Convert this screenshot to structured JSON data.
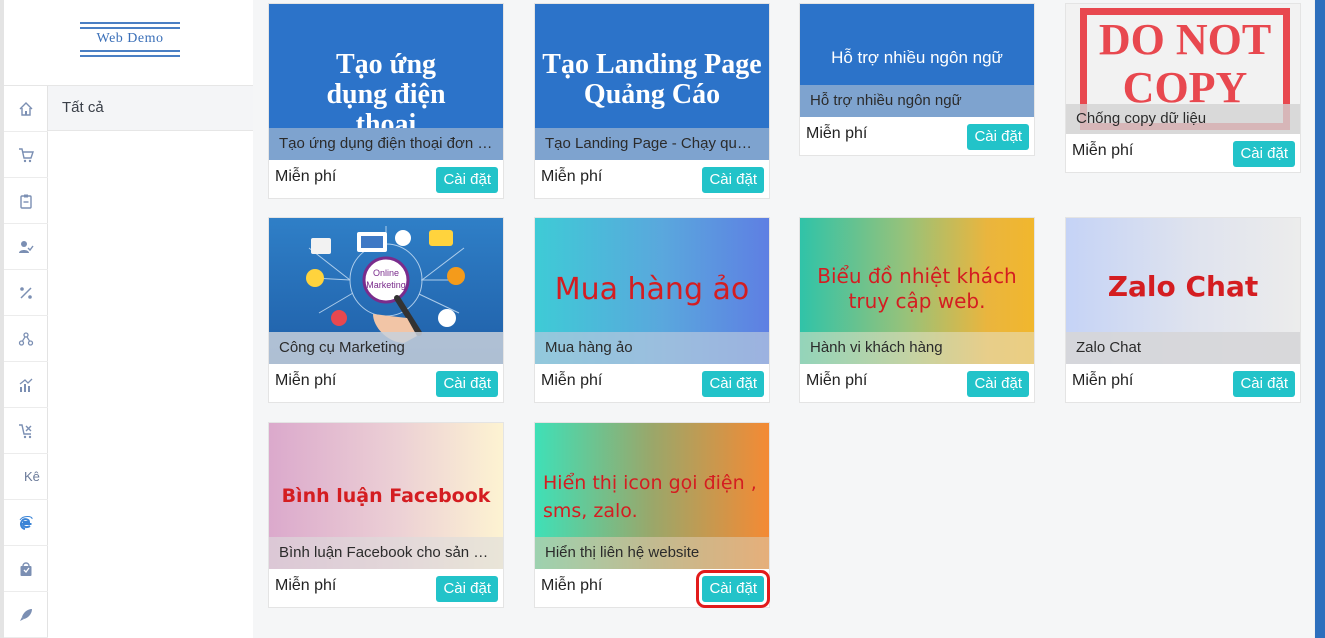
{
  "logo": {
    "text": "Web Demo"
  },
  "sidebar": {
    "rail": [
      {
        "icon": "home-icon"
      },
      {
        "icon": "cart-icon"
      },
      {
        "icon": "clipboard-icon"
      },
      {
        "icon": "user-check-icon"
      },
      {
        "icon": "percent-icon"
      },
      {
        "icon": "network-icon"
      },
      {
        "icon": "chart-icon"
      },
      {
        "icon": "cart-x-icon"
      },
      {
        "text": "Kê"
      },
      {
        "icon": "internet-explorer-icon"
      },
      {
        "icon": "bag-icon"
      },
      {
        "icon": "rocket-icon"
      }
    ],
    "submenu_item": "Tất cả"
  },
  "apps": [
    {
      "thumb_title": "Tạo ứng dụng điện thoại",
      "name": "Tạo ứng dụng điện thoại đơn giản",
      "price": "Miễn phí",
      "install": "Cài đặt"
    },
    {
      "thumb_title": "Tạo Landing Page Quảng Cáo",
      "name": "Tạo Landing Page - Chạy quảng cáo",
      "price": "Miễn phí",
      "install": "Cài đặt"
    },
    {
      "thumb_title": "Hỗ trợ nhiều ngôn ngữ",
      "name": "Hỗ trợ nhiều ngôn ngữ",
      "price": "Miễn phí",
      "install": "Cài đặt"
    },
    {
      "thumb_title": "DO NOT COPY",
      "name": "Chống copy dữ liệu",
      "price": "Miễn phí",
      "install": "Cài đặt"
    },
    {
      "thumb_title": "Online Marketing",
      "name": "Công cụ Marketing",
      "price": "Miễn phí",
      "install": "Cài đặt"
    },
    {
      "thumb_title": "Mua hàng ảo",
      "name": "Mua hàng ảo",
      "price": "Miễn phí",
      "install": "Cài đặt"
    },
    {
      "thumb_title": "Biểu đồ nhiệt khách truy cập web.",
      "name": "Hành vi khách hàng",
      "price": "Miễn phí",
      "install": "Cài đặt"
    },
    {
      "thumb_title": "Zalo Chat",
      "name": "Zalo Chat",
      "price": "Miễn phí",
      "install": "Cài đặt"
    },
    {
      "thumb_title": "Bình luận Facebook",
      "name": "Bình luận Facebook cho sản phẩm",
      "price": "Miễn phí",
      "install": "Cài đặt"
    },
    {
      "thumb_title": "Hiển thị icon gọi điện , sms, zalo.",
      "name": "Hiển thị liên hệ website",
      "price": "Miễn phí",
      "install": "Cài đặt"
    }
  ],
  "colors": {
    "accent": "#22c3c9",
    "highlight": "#e21b1b",
    "sidebar_icon": "#7b8fb3"
  }
}
